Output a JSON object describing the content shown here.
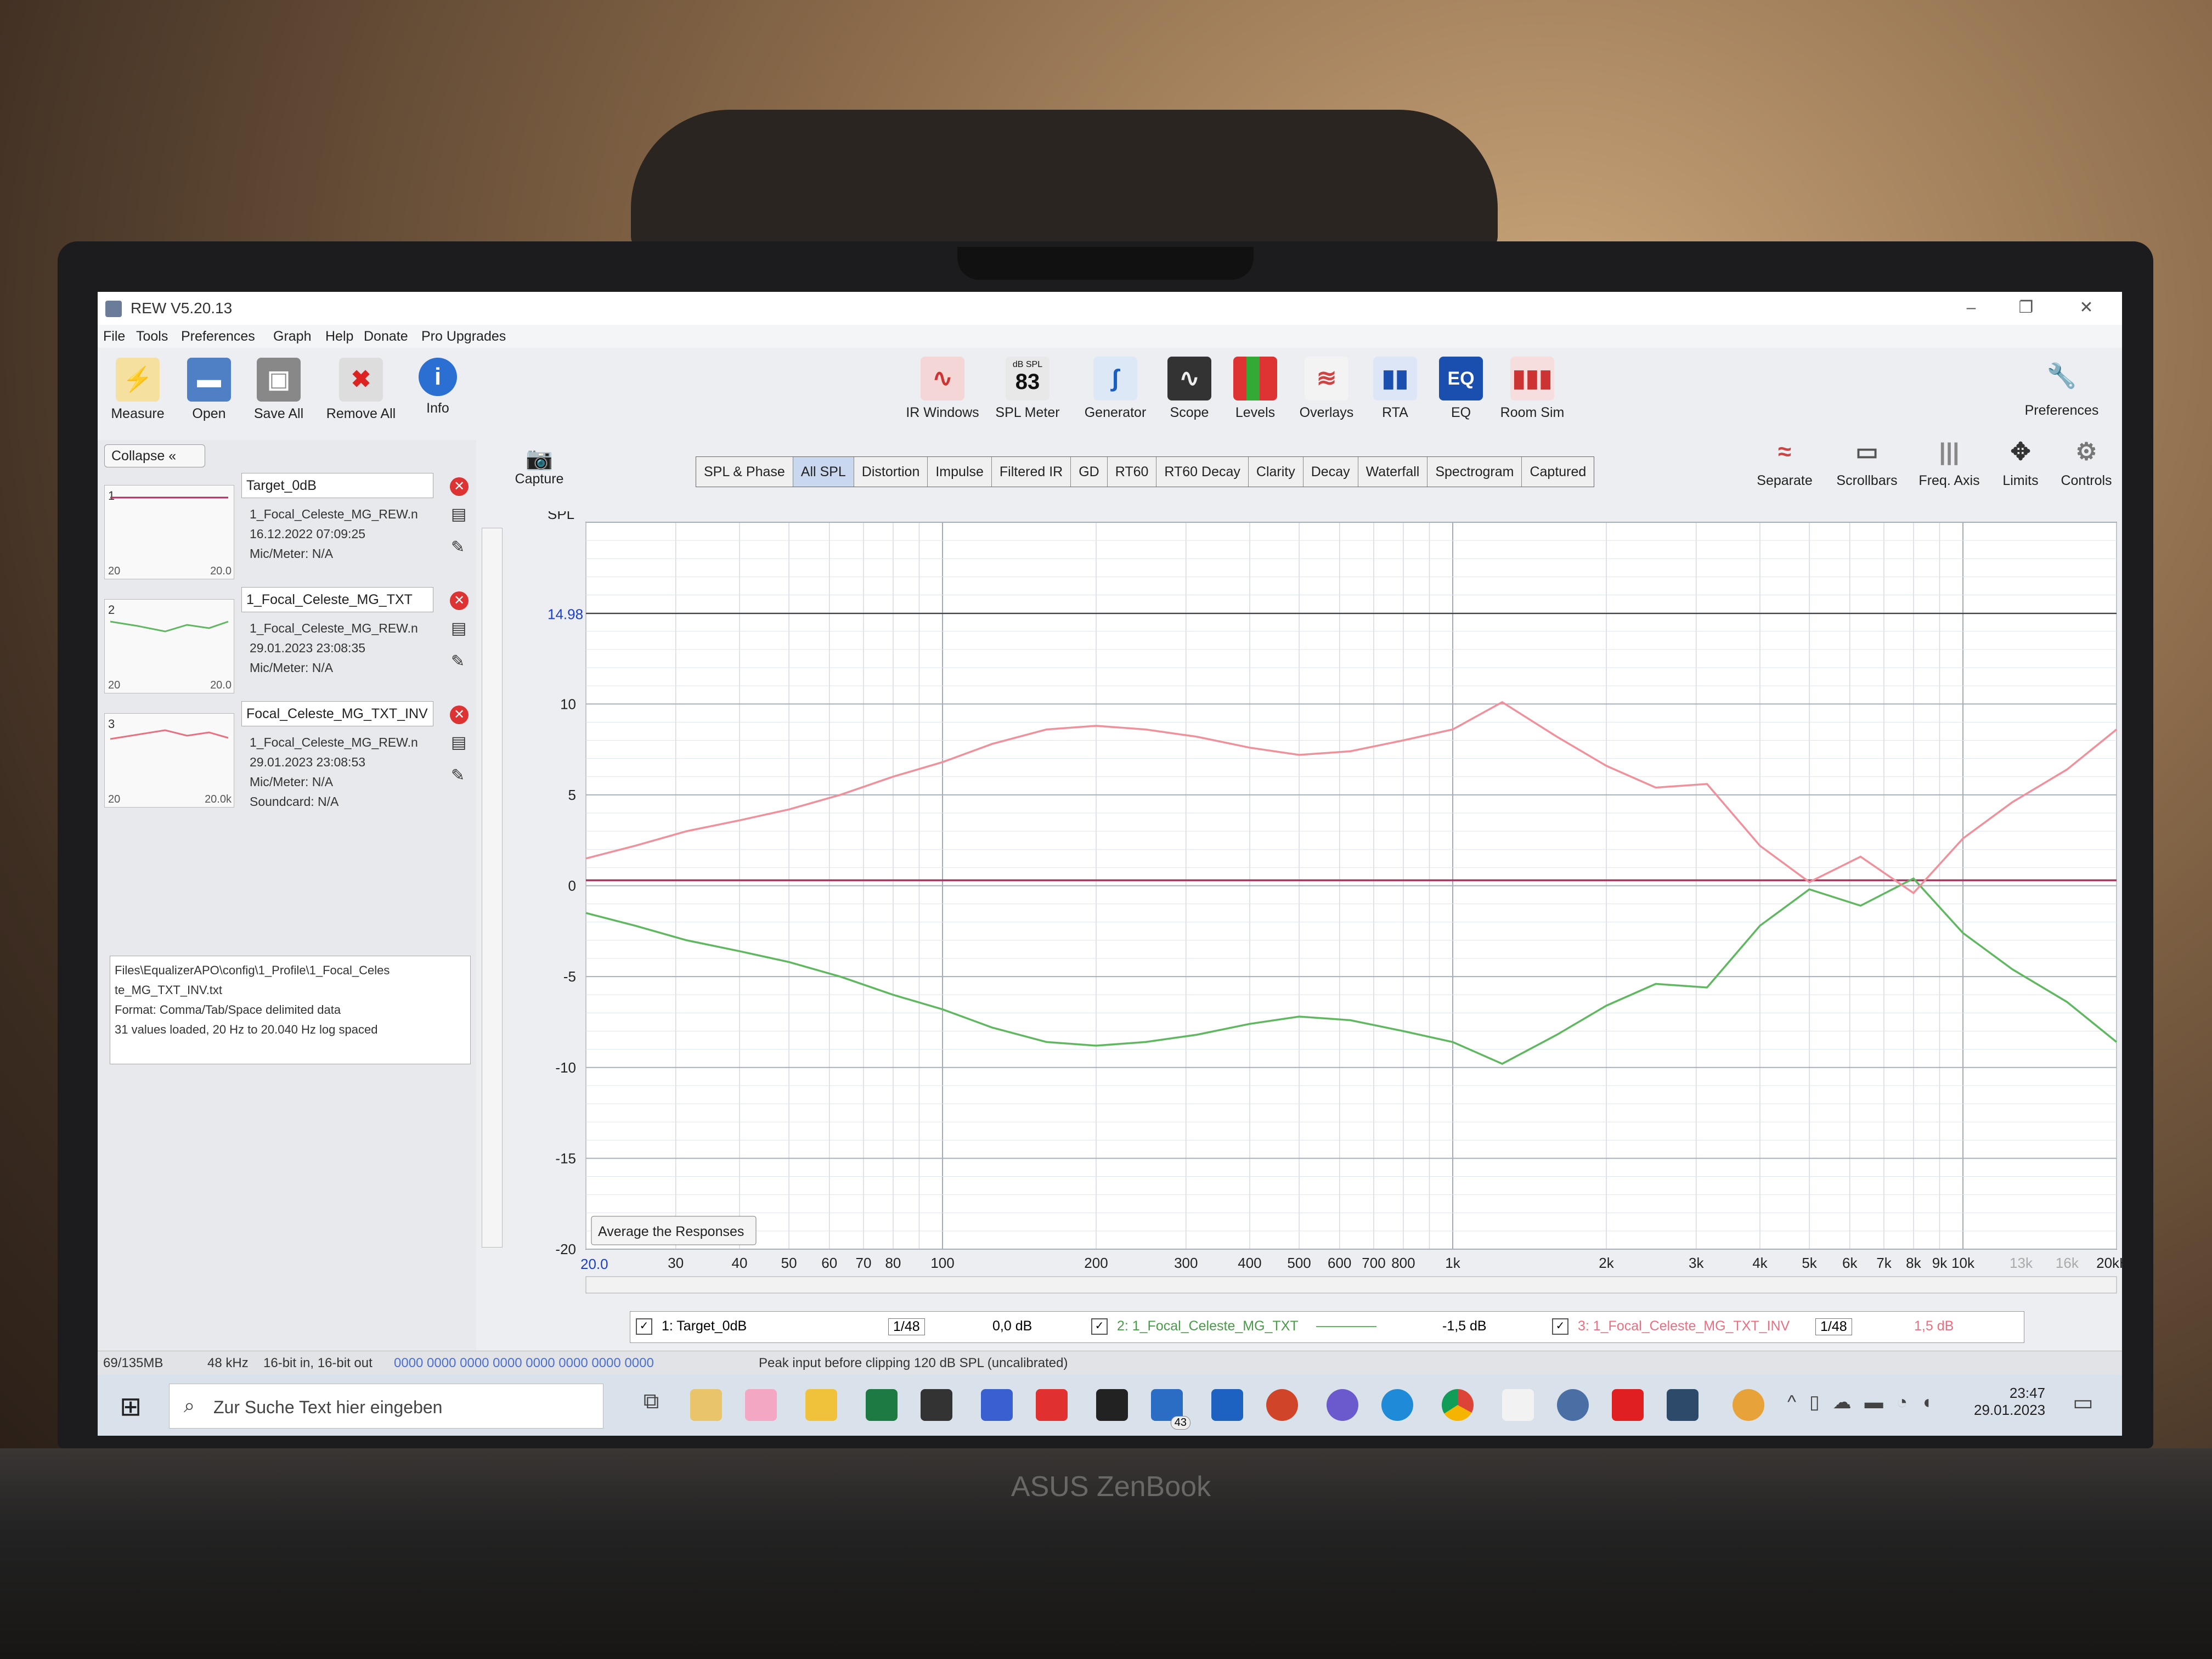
{
  "window": {
    "title": "REW V5.20.13"
  },
  "menu": [
    "File",
    "Tools",
    "Preferences",
    "Graph",
    "Help",
    "Donate",
    "Pro Upgrades"
  ],
  "toolbar_left": [
    {
      "label": "Measure",
      "icon": "measure-icon"
    },
    {
      "label": "Open",
      "icon": "folder-icon"
    },
    {
      "label": "Save All",
      "icon": "save-icon"
    },
    {
      "label": "Remove All",
      "icon": "remove-all-icon"
    },
    {
      "label": "Info",
      "icon": "info-icon"
    }
  ],
  "toolbar_center": [
    {
      "label": "IR Windows",
      "icon": "ir-windows-icon"
    },
    {
      "label": "SPL Meter",
      "icon": "spl-meter-icon",
      "badge_top": "dB SPL",
      "badge_value": "83"
    },
    {
      "label": "Generator",
      "icon": "generator-icon"
    },
    {
      "label": "Scope",
      "icon": "scope-icon"
    },
    {
      "label": "Levels",
      "icon": "levels-icon"
    },
    {
      "label": "Overlays",
      "icon": "overlays-icon"
    },
    {
      "label": "RTA",
      "icon": "rta-icon"
    },
    {
      "label": "EQ",
      "icon": "eq-icon"
    },
    {
      "label": "Room Sim",
      "icon": "room-sim-icon"
    }
  ],
  "toolbar_right": {
    "label": "Preferences",
    "icon": "wrench-icon"
  },
  "graph_tools": [
    {
      "label": "Separate",
      "icon": "separate-icon"
    },
    {
      "label": "Scrollbars",
      "icon": "scrollbars-icon"
    },
    {
      "label": "Freq. Axis",
      "icon": "freq-axis-icon"
    },
    {
      "label": "Limits",
      "icon": "limits-icon"
    },
    {
      "label": "Controls",
      "icon": "gear-icon"
    }
  ],
  "panel": {
    "collapse_label": "Collapse",
    "measurements": [
      {
        "num": "1",
        "name": "Target_0dB",
        "file": "1_Focal_Celeste_MG_REW.n",
        "date": "16.12.2022 07:09:25",
        "mic": "Mic/Meter: N/A",
        "thumb_l": "20",
        "thumb_r": "20.0"
      },
      {
        "num": "2",
        "name": "1_Focal_Celeste_MG_TXT",
        "file": "1_Focal_Celeste_MG_REW.n",
        "date": "29.01.2023 23:08:35",
        "mic": "Mic/Meter: N/A",
        "thumb_l": "20",
        "thumb_r": "20.0"
      },
      {
        "num": "3",
        "name": "Focal_Celeste_MG_TXT_INV",
        "file": "1_Focal_Celeste_MG_REW.n",
        "date": "29.01.2023 23:08:53",
        "mic": "Mic/Meter: N/A",
        "soundcard": "Soundcard: N/A",
        "thumb_l": "20",
        "thumb_r": "20.0k"
      }
    ],
    "notes": [
      "Files\\EqualizerAPO\\config\\1_Profile\\1_Focal_Celes",
      "te_MG_TXT_INV.txt",
      "Format: Comma/Tab/Space delimited data",
      "31 values loaded, 20 Hz to 20.040 Hz log spaced"
    ]
  },
  "capture_label": "Capture",
  "tabs": [
    "SPL & Phase",
    "All SPL",
    "Distortion",
    "Impulse",
    "Filtered IR",
    "GD",
    "RT60",
    "RT60 Decay",
    "Clarity",
    "Decay",
    "Waterfall",
    "Spectrogram",
    "Captured"
  ],
  "active_tab": "All SPL",
  "average_button": "Average the Responses",
  "chart_data": {
    "type": "line",
    "ylabel": "SPL",
    "x_scale": "log",
    "xlim": [
      20,
      20000
    ],
    "ylim": [
      -20,
      20
    ],
    "cursor_y": "14.98",
    "cursor_x": "20.0",
    "y_ticks": [
      "10",
      "5",
      "0",
      "-5",
      "-10",
      "-15",
      "-20"
    ],
    "x_ticks": [
      {
        "v": 30,
        "t": "30"
      },
      {
        "v": 40,
        "t": "40"
      },
      {
        "v": 50,
        "t": "50"
      },
      {
        "v": 60,
        "t": "60"
      },
      {
        "v": 70,
        "t": "70"
      },
      {
        "v": 80,
        "t": "80"
      },
      {
        "v": 100,
        "t": "100"
      },
      {
        "v": 200,
        "t": "200"
      },
      {
        "v": 300,
        "t": "300"
      },
      {
        "v": 400,
        "t": "400"
      },
      {
        "v": 500,
        "t": "500"
      },
      {
        "v": 600,
        "t": "600"
      },
      {
        "v": 700,
        "t": "700"
      },
      {
        "v": 800,
        "t": "800"
      },
      {
        "v": 1000,
        "t": "1k"
      },
      {
        "v": 2000,
        "t": "2k"
      },
      {
        "v": 3000,
        "t": "3k"
      },
      {
        "v": 4000,
        "t": "4k"
      },
      {
        "v": 5000,
        "t": "5k"
      },
      {
        "v": 6000,
        "t": "6k"
      },
      {
        "v": 7000,
        "t": "7k"
      },
      {
        "v": 8000,
        "t": "8k"
      },
      {
        "v": 9000,
        "t": "9k"
      },
      {
        "v": 10000,
        "t": "10k"
      },
      {
        "v": 13000,
        "t": "13k"
      },
      {
        "v": 16000,
        "t": "16k"
      },
      {
        "v": 20000,
        "t": "20kHz"
      }
    ],
    "x": [
      20,
      25,
      31.5,
      40,
      50,
      63,
      80,
      100,
      125,
      160,
      200,
      250,
      315,
      400,
      500,
      630,
      800,
      1000,
      1250,
      1600,
      2000,
      2500,
      3150,
      4000,
      5000,
      6300,
      8000,
      10000,
      12500,
      16000,
      20000
    ],
    "series": [
      {
        "name": "1: Target_0dB",
        "color": "#b03060",
        "values": [
          0.3,
          0.3,
          0.3,
          0.3,
          0.3,
          0.3,
          0.3,
          0.3,
          0.3,
          0.3,
          0.3,
          0.3,
          0.3,
          0.3,
          0.3,
          0.3,
          0.3,
          0.3,
          0.3,
          0.3,
          0.3,
          0.3,
          0.3,
          0.3,
          0.3,
          0.3,
          0.3,
          0.3,
          0.3,
          0.3,
          0.3
        ]
      },
      {
        "name": "2: 1_Focal_Celeste_MG_TXT",
        "color": "#5fb860",
        "values": [
          -1.5,
          -2.2,
          -3.0,
          -3.6,
          -4.2,
          -5.0,
          -6.0,
          -6.8,
          -7.8,
          -8.6,
          -8.8,
          -8.6,
          -8.2,
          -7.6,
          -7.2,
          -7.4,
          -8.0,
          -8.6,
          -9.8,
          -8.2,
          -6.6,
          -5.4,
          -5.6,
          -2.2,
          -0.2,
          -1.1,
          0.4,
          -2.6,
          -4.6,
          -6.4,
          -8.6
        ]
      },
      {
        "name": "3: 1_Focal_Celeste_MG_TXT_INV",
        "color": "#f0909a",
        "values": [
          1.5,
          2.2,
          3.0,
          3.6,
          4.2,
          5.0,
          6.0,
          6.8,
          7.8,
          8.6,
          8.8,
          8.6,
          8.2,
          7.6,
          7.2,
          7.4,
          8.0,
          8.6,
          10.1,
          8.2,
          6.6,
          5.4,
          5.6,
          2.2,
          0.2,
          1.6,
          -0.4,
          2.6,
          4.6,
          6.4,
          8.6
        ]
      }
    ]
  },
  "legend": [
    {
      "label": "1: Target_0dB",
      "value": "0,0 dB",
      "smooth": "1/48"
    },
    {
      "label": "2: 1_Focal_Celeste_MG_TXT",
      "value": "-1,5 dB"
    },
    {
      "label": "3: 1_Focal_Celeste_MG_TXT_INV",
      "value": "1,5 dB",
      "smooth": "1/48"
    }
  ],
  "status": {
    "memory": "69/135MB",
    "rate": "48 kHz",
    "bits": "16-bit in, 16-bit out",
    "hex": "0000 0000  0000 0000  0000 0000  0000 0000",
    "peak": "Peak input before clipping 120 dB SPL (uncalibrated)"
  },
  "taskbar": {
    "search_placeholder": "Zur Suche Text hier eingeben",
    "time": "23:47",
    "date": "29.01.2023",
    "mail_badge": "43"
  },
  "laptop_brand": "ASUS ZenBook",
  "colors": {
    "target": "#b03060",
    "txt": "#5fb860",
    "inv": "#f0909a",
    "accent": "#2a6fd1"
  }
}
